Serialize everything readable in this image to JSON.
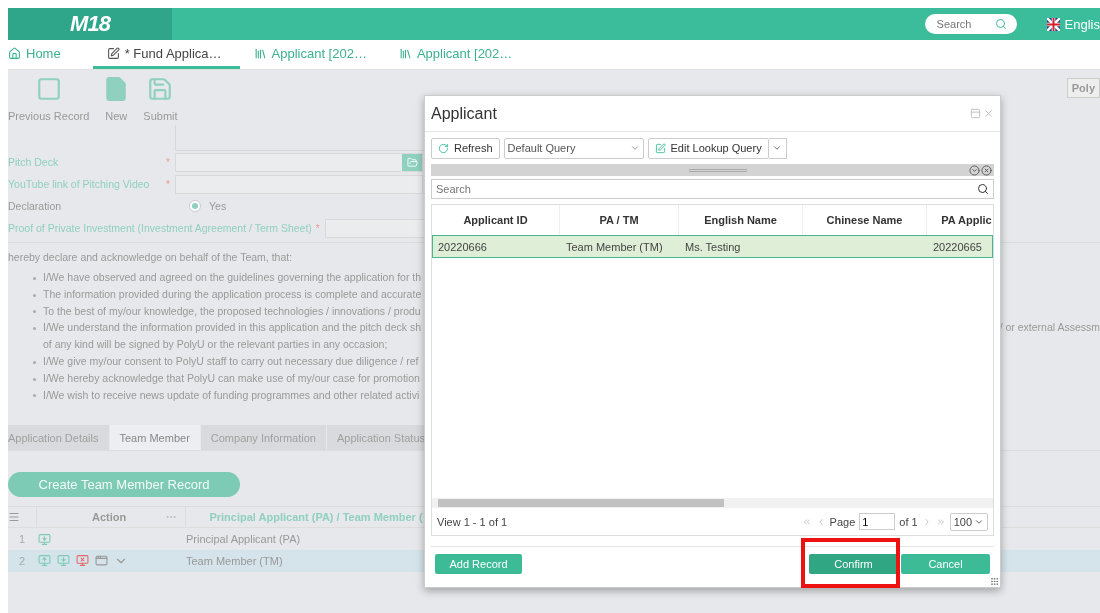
{
  "header": {
    "logo": "M18",
    "search": {
      "placeholder": "Search"
    },
    "language": "Englis"
  },
  "tabs": [
    {
      "label": "Home",
      "kind": "home",
      "selected": false
    },
    {
      "label": "* Fund Applica…",
      "kind": "form",
      "selected": true
    },
    {
      "label": "Applicant [202…",
      "kind": "record",
      "selected": false
    },
    {
      "label": "Applicant [202…",
      "kind": "record",
      "selected": false
    }
  ],
  "toolbar": [
    {
      "label": "Previous Record",
      "kind": "previous"
    },
    {
      "label": "New",
      "kind": "new"
    },
    {
      "label": "Submit",
      "kind": "submit"
    }
  ],
  "side_button": "Poly",
  "form": {
    "fields": [
      {
        "label": "Pitch Deck",
        "required": true,
        "mark": "*",
        "kind": "file"
      },
      {
        "label": "YouTube link of Pitching Video",
        "required": true,
        "mark": "*",
        "kind": "text"
      },
      {
        "label": "Declaration",
        "required": false,
        "kind": "radio",
        "option": "Yes",
        "checked": true
      },
      {
        "label": "Proof of Private Investment (Investment Agreement / Term Sheet)",
        "required": true,
        "mark": "*",
        "kind": "text"
      }
    ]
  },
  "declaration": {
    "intro": "hereby declare and acknowledge on behalf of the Team, that:",
    "bullets": [
      {
        "text": "I/We have observed and agreed on the guidelines governing the application for th"
      },
      {
        "text": "The information provided during the application process is complete and accurate"
      },
      {
        "text": "To the best of my/our knowledge, the proposed technologies / innovations / produ"
      },
      {
        "text": "I/We understand the information provided in this application and the pitch deck sh",
        "tail": "/ or external Assessm",
        "more": "of any kind will be signed by PolyU or the relevant parties in any occasion;"
      },
      {
        "text": "I/We give my/our consent to PolyU staff to carry out necessary due diligence / ref"
      },
      {
        "text": "I/We hereby acknowledge that PolyU can make use of my/our case for promotion"
      },
      {
        "text": "I/We wish to receive news update of funding programmes and other related activi"
      }
    ]
  },
  "detail_tabs": [
    {
      "label": "Application Details",
      "selected": false
    },
    {
      "label": "Team Member",
      "selected": true
    },
    {
      "label": "Company Information",
      "selected": false
    },
    {
      "label": "Application Status",
      "selected": false
    }
  ],
  "create_button": "Create Team Member Record",
  "member_grid": {
    "columns": {
      "action": "Action",
      "role": "Principal Applicant (PA) / Team Member ("
    },
    "rows": [
      {
        "number": "1",
        "actions": [
          {
            "kind": "insert"
          }
        ],
        "role": "Principal Applicant (PA)",
        "selected": false
      },
      {
        "number": "2",
        "actions": [
          {
            "kind": "add"
          },
          {
            "kind": "insert"
          },
          {
            "kind": "delete"
          },
          {
            "kind": "copy"
          },
          {
            "kind": "expand"
          }
        ],
        "role": "Team Member (TM)",
        "selected": true
      }
    ]
  },
  "dialog": {
    "title": "Applicant",
    "refresh": "Refresh",
    "query": "Default Query",
    "edit_query": "Edit Lookup Query",
    "search": {
      "placeholder": "Search"
    },
    "columns": [
      "Applicant ID",
      "PA / TM",
      "English Name",
      "Chinese Name",
      "PA Applic"
    ],
    "rows": [
      {
        "cells": [
          "20220666",
          "Team Member (TM)",
          "Ms. Testing",
          "",
          "20220665"
        ],
        "selected": true
      }
    ],
    "pager": {
      "summary": "View 1 - 1 of 1",
      "page_label": "Page",
      "page": "1",
      "of": "of 1",
      "page_size": "100"
    },
    "buttons": [
      {
        "label": "Add Record",
        "kind": "add",
        "highlighted": false
      },
      {
        "label": "Confirm",
        "kind": "confirm",
        "highlighted": true
      },
      {
        "label": "Cancel",
        "kind": "cancel",
        "highlighted": false
      }
    ]
  }
}
